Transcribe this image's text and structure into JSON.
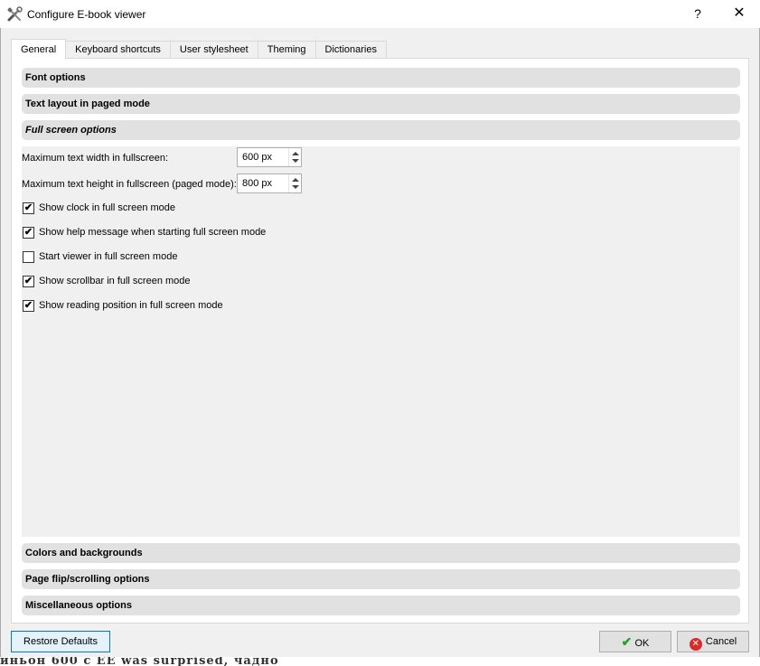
{
  "window": {
    "title": "Configure E-book viewer",
    "help_label": "?",
    "close_label": "✕",
    "icon": "tools-icon"
  },
  "tabs": [
    {
      "label": "General",
      "active": true
    },
    {
      "label": "Keyboard shortcuts",
      "active": false
    },
    {
      "label": "User stylesheet",
      "active": false
    },
    {
      "label": "Theming",
      "active": false
    },
    {
      "label": "Dictionaries",
      "active": false
    }
  ],
  "sections": {
    "font_options": "Font options",
    "text_layout": "Text layout in paged mode",
    "full_screen": "Full screen options",
    "colors": "Colors and backgrounds",
    "page_flip": "Page flip/scrolling options",
    "misc": "Miscellaneous options"
  },
  "full_screen": {
    "max_width_label": "Maximum text width in fullscreen:",
    "max_width_value": "600 px",
    "max_height_label": "Maximum text height in fullscreen (paged mode):",
    "max_height_value": "800 px",
    "checkboxes": [
      {
        "label": "Show clock in full screen mode",
        "checked": true
      },
      {
        "label": "Show help message when starting full screen mode",
        "checked": true
      },
      {
        "label": "Start viewer in full screen mode",
        "checked": false
      },
      {
        "label": "Show scrollbar in full screen mode",
        "checked": true
      },
      {
        "label": "Show reading position in full screen mode",
        "checked": true
      }
    ]
  },
  "buttons": {
    "restore_defaults": "Restore Defaults",
    "ok": "OK",
    "cancel": "Cancel"
  },
  "colors": {
    "accent": "#0078d7",
    "ok_icon": "#2e9c2e",
    "cancel_icon": "#d82b2b"
  },
  "background_text": "иньон 600 с ЕЕ was surprised, чадно"
}
